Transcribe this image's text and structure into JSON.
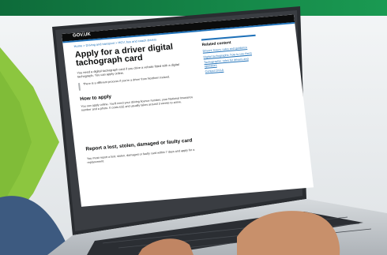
{
  "colors": {
    "banner_start": "#0e6b3a",
    "banner_end": "#1a9a52",
    "arrow": "#8cc63f",
    "laptop_body": "#3a3d42",
    "laptop_base": "#c9cdd2",
    "gov_header": "#0b0c0c",
    "gov_blue": "#1d70b8"
  },
  "webpage": {
    "logo": "GOV.UK",
    "breadcrumb": "Home  >  Driving and transport  >  HGV, bus and coach drivers",
    "title": "Apply for a driver digital tachograph card",
    "lead": "You need a digital tachograph card if you drive a vehicle fitted with a digital tachograph. You can apply online.",
    "inset": "There is a different process if you're a driver from Northern Ireland.",
    "how_heading": "How to apply",
    "how_text": "You can apply online. You'll need your driving licence number, your National Insurance number and a photo. It costs £32 and usually takes around 3 weeks to arrive.",
    "report_heading": "Report a lost, stolen, damaged or faulty card",
    "report_text": "You must report a lost, stolen, damaged or faulty card within 7 days and apply for a replacement.",
    "sidebar_title": "Related content",
    "sidebar_links": [
      "Drivers' hours: rules and guidance",
      "Digital tachographs: how to use them",
      "Tachographs: rules for drivers and operators",
      "Contact DVLA"
    ]
  }
}
